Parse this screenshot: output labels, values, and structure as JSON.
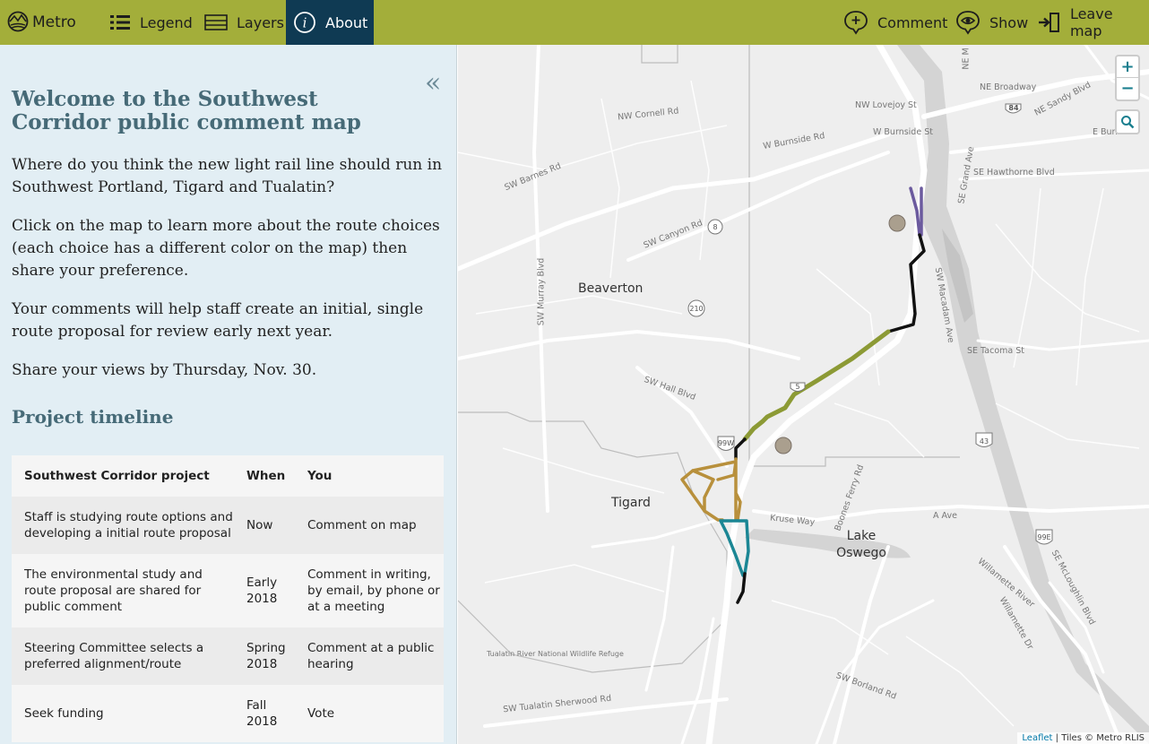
{
  "topbar": {
    "logo_label": "Metro",
    "legend_label": "Legend",
    "layers_label": "Layers",
    "about_label": "About",
    "comment_label": "Comment",
    "show_label": "Show",
    "leave_label": "Leave map",
    "colors": {
      "bar": "#a3ae3a",
      "active_tab": "#0f3a53"
    }
  },
  "sidebar": {
    "collapse_glyph": "«",
    "welcome_title": "Welcome to the Southwest Corridor public comment map",
    "paragraphs": [
      "Where do you think the new light rail line should run in Southwest Portland, Tigard and Tualatin?",
      "Click on the map to learn more about the route choices (each choice has a different color on the map) then share your preference.",
      "Your comments will help staff create an initial, single route proposal for review early next year.",
      "Share your views by Thursday, Nov. 30."
    ],
    "timeline_heading": "Project timeline",
    "timeline_table": {
      "headers": [
        "Southwest Corridor project",
        "When",
        "You"
      ],
      "rows": [
        [
          "Staff is studying route options and developing a initial route proposal",
          "Now",
          "Comment on map"
        ],
        [
          "The environmental study and route proposal are shared for public comment",
          "Early 2018",
          "Comment in writing, by email, by phone or at a meeting"
        ],
        [
          "Steering Committee selects a preferred alignment/route",
          "Spring 2018",
          "Comment at a public hearing"
        ],
        [
          "Seek funding",
          "Fall 2018",
          "Vote"
        ]
      ]
    }
  },
  "map": {
    "zoom_in": "+",
    "zoom_out": "−",
    "cities": [
      "Beaverton",
      "Tigard",
      "Lake Oswego"
    ],
    "roads": [
      "NW Cornell Rd",
      "NW Lovejoy St",
      "NE Broadway",
      "W Burnside Rd",
      "W Burnside St",
      "E Burnside",
      "SE Hawthorne Blvd",
      "SW Barnes Rd",
      "SW Canyon Rd",
      "SW Murray Blvd",
      "SW Macadam Ave",
      "SE Tacoma St",
      "SW Hall Blvd",
      "Kruse Way",
      "Boones Ferry Rd",
      "A Ave",
      "SE McLoughlin Blvd",
      "Willamette Dr",
      "SW Borland Rd",
      "SW Tualatin Sherwood Rd",
      "Tualatin River National Wildlife Refuge",
      "NE Sandy Blvd",
      "SE Grand Ave",
      "NE M",
      "Willamette River"
    ],
    "shields": [
      "84",
      "8",
      "210",
      "5",
      "99W",
      "43",
      "99E"
    ],
    "attribution_link": "Leaflet",
    "attribution_text": "| Tiles © Metro RLIS",
    "route_colors": {
      "purple": "#6b5a9e",
      "black": "#111111",
      "olive": "#8c9a35",
      "gold": "#b8903c",
      "teal": "#1b8694"
    }
  }
}
